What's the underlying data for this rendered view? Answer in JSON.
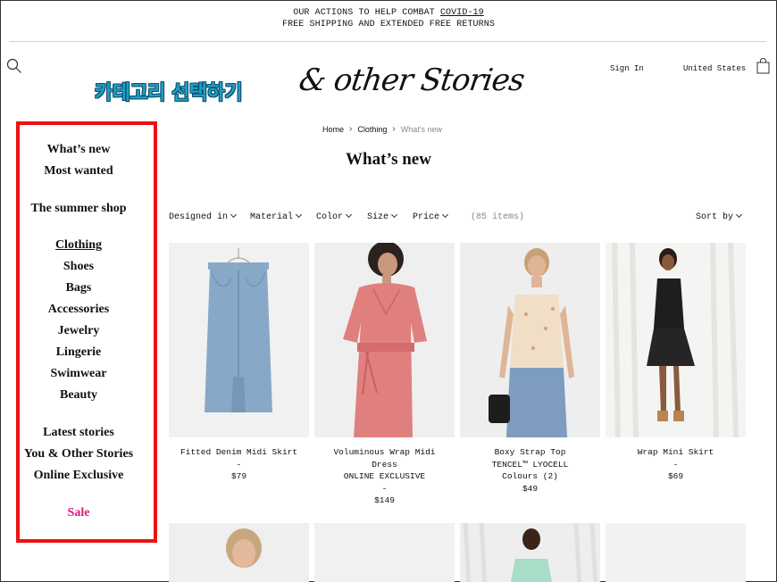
{
  "promo": {
    "line1_prefix": "OUR ACTIONS TO HELP COMBAT ",
    "line1_link": "COVID-19",
    "line2": "FREE SHIPPING AND EXTENDED FREE RETURNS"
  },
  "header": {
    "annotation": "카테고리 선택하기",
    "logo": "& other Stories",
    "sign_in": "Sign In",
    "country": "United States",
    "icons": {
      "search": "search-icon",
      "bag": "shopping-bag-icon"
    }
  },
  "breadcrumb": [
    "Home",
    "Clothing",
    "What's new"
  ],
  "page_title": "What’s new",
  "sidebar": {
    "items": [
      {
        "label": "What’s new"
      },
      {
        "label": "Most wanted"
      },
      {
        "label": "The summer shop"
      },
      {
        "label": "Clothing"
      },
      {
        "label": "Shoes"
      },
      {
        "label": "Bags"
      },
      {
        "label": "Accessories"
      },
      {
        "label": "Jewelry"
      },
      {
        "label": "Lingerie"
      },
      {
        "label": "Swimwear"
      },
      {
        "label": "Beauty"
      },
      {
        "label": "Latest stories"
      },
      {
        "label": "You & Other Stories"
      },
      {
        "label": "Online Exclusive"
      },
      {
        "label": "Sale"
      }
    ],
    "highlight_color": "#ee1111",
    "sale_color": "#e0187f"
  },
  "filters": {
    "designed_in": "Designed in",
    "material": "Material",
    "color": "Color",
    "size": "Size",
    "price": "Price",
    "count": "(85 items)",
    "sort": "Sort by"
  },
  "products": [
    {
      "name": "Fitted Denim Midi Skirt",
      "line2": "-",
      "line3": "$79",
      "line4": "",
      "line5": ""
    },
    {
      "name": "Voluminous Wrap Midi",
      "line2": "Dress",
      "line3": "ONLINE EXCLUSIVE",
      "line4": "-",
      "line5": "$149"
    },
    {
      "name": "Boxy Strap Top",
      "line2": "TENCEL™ LYOCELL",
      "line3": "Colours (2)",
      "line4": "$49",
      "line5": ""
    },
    {
      "name": "Wrap Mini Skirt",
      "line2": "-",
      "line3": "$69",
      "line4": "",
      "line5": ""
    }
  ]
}
